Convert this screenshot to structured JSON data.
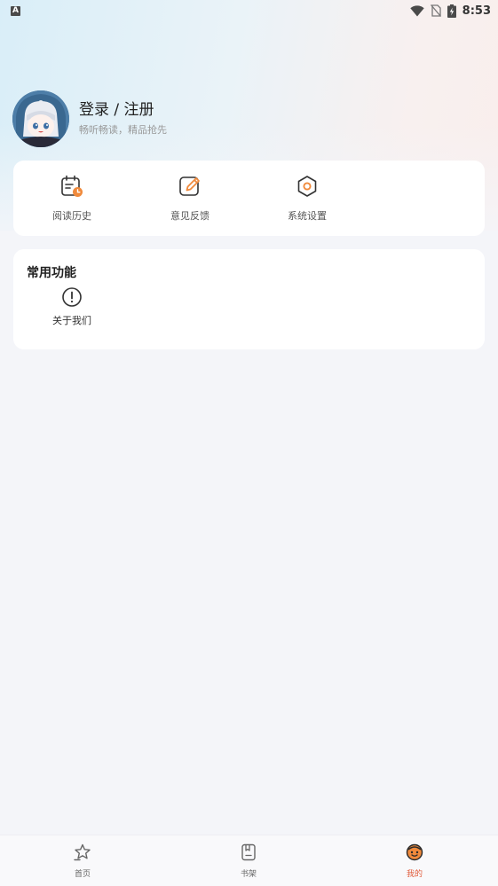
{
  "status_bar": {
    "left_icon": "A",
    "time": "8:53",
    "icons": [
      "wifi-icon",
      "no-sim-icon",
      "battery-charging-icon"
    ]
  },
  "profile": {
    "title": "登录 / 注册",
    "subtitle": "畅听畅读，精品抢先",
    "avatar_icon": "anime-avatar"
  },
  "quick_actions": [
    {
      "label": "阅读历史",
      "icon": "reading-history-icon"
    },
    {
      "label": "意见反馈",
      "icon": "feedback-edit-icon"
    },
    {
      "label": "系统设置",
      "icon": "settings-hexagon-icon"
    }
  ],
  "common": {
    "title": "常用功能",
    "items": [
      {
        "label": "关于我们",
        "icon": "info-exclamation-icon"
      }
    ]
  },
  "bottom_nav": [
    {
      "label": "首页",
      "icon": "home-star-icon",
      "active": false
    },
    {
      "label": "书架",
      "icon": "bookshelf-icon",
      "active": false
    },
    {
      "label": "我的",
      "icon": "profile-face-icon",
      "active": true
    }
  ],
  "colors": {
    "accent": "#e05a3a",
    "icon_orange": "#f08a3c"
  }
}
